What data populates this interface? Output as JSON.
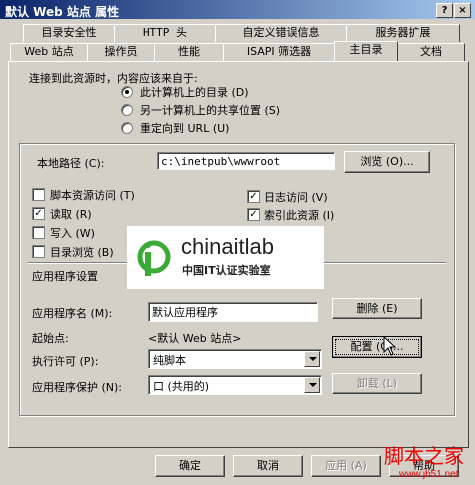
{
  "window": {
    "title": "默认 Web 站点 属性",
    "help_btn": "?",
    "close_btn": "×"
  },
  "tabs_back": [
    "目录安全性",
    "HTTP 头",
    "自定义错误信息",
    "服务器扩展"
  ],
  "tabs_front": [
    "Web 站点",
    "操作员",
    "性能",
    "ISAPI 筛选器",
    "主目录",
    "文档"
  ],
  "active_tab": "主目录",
  "source": {
    "prompt": "连接到此资源时，内容应该来自于:",
    "options": [
      "此计算机上的目录 (D)",
      "另一计算机上的共享位置 (S)",
      "重定向到 URL (U)"
    ],
    "selected": 0
  },
  "local_path": {
    "label": "本地路径 (C):",
    "value": "c:\\inetpub\\wwwroot",
    "browse": "浏览 (O)..."
  },
  "permissions": {
    "script_access": "脚本资源访问 (T)",
    "read": "读取 (R)",
    "write": "写入 (W)",
    "dir_browse": "目录浏览 (B)",
    "log_visits": "日志访问 (V)",
    "index_resource": "索引此资源 (I)",
    "check_mark": "✓"
  },
  "app_settings": {
    "section_label": "应用程序设置",
    "app_name_label": "应用程序名 (M):",
    "app_name_value": "默认应用程序",
    "start_point_label": "起始点:",
    "start_point_value": "<默认 Web 站点>",
    "exec_perm_label": "执行许可 (P):",
    "exec_perm_value": "纯脚本",
    "app_protect_label": "应用程序保护 (N):",
    "app_protect_value": "口 (共用的)",
    "remove": "删除 (E)",
    "config": "配置 (G)...",
    "unload": "卸载 (L)"
  },
  "footer": {
    "ok": "确定",
    "cancel": "取消",
    "apply": "应用 (A)",
    "help": "帮助"
  },
  "logo": {
    "name": "chinaitlab",
    "tagline": "中国IT认证实验室"
  },
  "watermark": {
    "text": "脚本之家",
    "url": "www.jb51.net"
  },
  "colors": {
    "title_start": "#0a246a",
    "title_end": "#a6caf0",
    "face": "#d4d0c8",
    "logo_green": "#3aa935",
    "watermark_red": "#e00000"
  }
}
